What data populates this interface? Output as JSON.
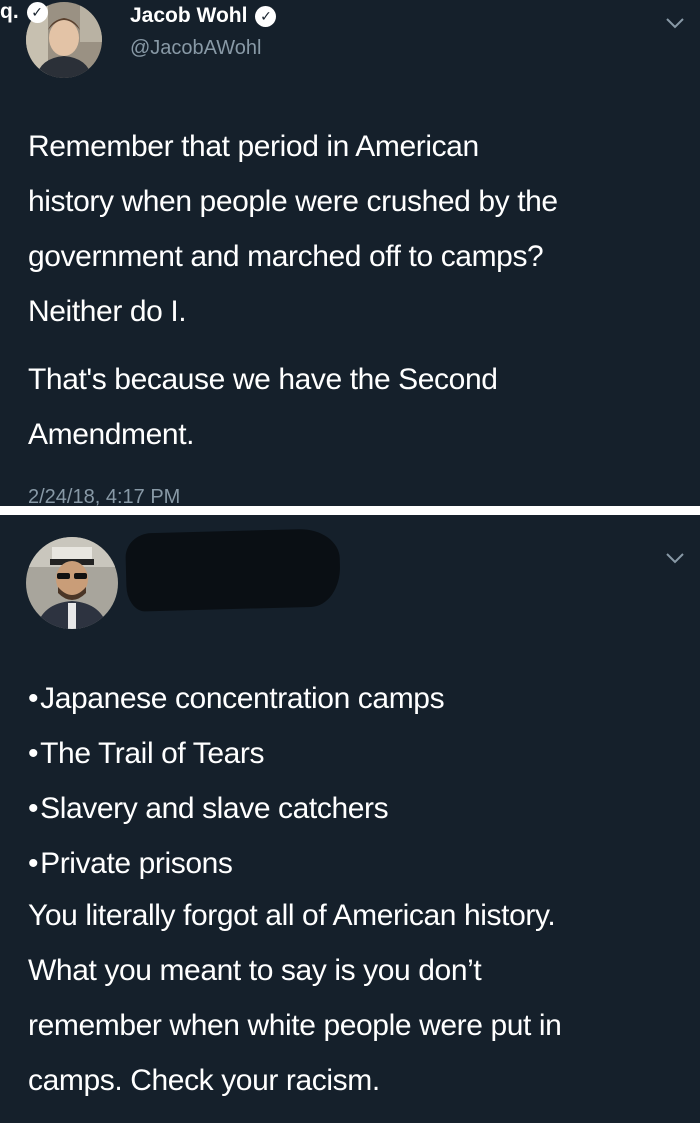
{
  "tweets": [
    {
      "display_name": "Jacob Wohl",
      "handle": "@JacobAWohl",
      "verified_icon": "verified-check-icon",
      "menu_icon": "chevron-down-icon",
      "paragraphs": [
        [
          "Remember that period in American",
          "history when people were crushed by the",
          "government and marched off to camps?",
          "Neither do I."
        ],
        [
          "That's because we have the Second",
          "Amendment."
        ]
      ],
      "timestamp": "2/24/18, 4:17 PM"
    },
    {
      "display_name_visible_fragment": "q.",
      "verified_icon": "verified-check-icon",
      "menu_icon": "chevron-down-icon",
      "bullets": [
        {
          "bullet": "•",
          "text": "Japanese concentration camps"
        },
        {
          "bullet": "•",
          "text": "The Trail of Tears"
        },
        {
          "bullet": "•",
          "text": "Slavery and slave catchers"
        },
        {
          "bullet": "•",
          "text": "Private prisons"
        }
      ],
      "paragraph": [
        "You literally forgot all of American history.",
        "What you meant to say is you don’t",
        "remember when white people were put in",
        "camps. Check your racism."
      ]
    }
  ],
  "colors": {
    "background": "#15202b",
    "text": "#ffffff",
    "secondary_text": "#8899a6",
    "divider": "#ffffff"
  }
}
